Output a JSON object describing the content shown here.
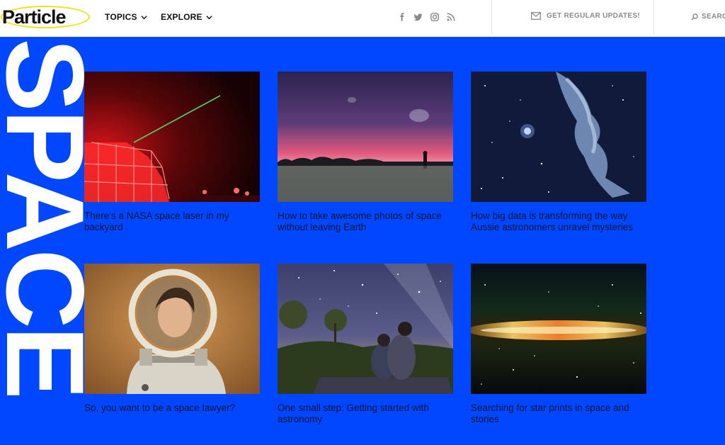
{
  "header": {
    "logo_text": "Particle",
    "nav": [
      {
        "label": "TOPICS"
      },
      {
        "label": "EXPLORE"
      }
    ],
    "social_icons": [
      "facebook-icon",
      "twitter-icon",
      "instagram-icon",
      "rss-icon"
    ],
    "updates_label": "GET REGULAR UPDATES!",
    "search_label": "SEARCH"
  },
  "section": {
    "title": "SPACE"
  },
  "articles": [
    {
      "title": "There’s a NASA space laser in my backyard"
    },
    {
      "title": "How to take awesome photos of space without leaving Earth"
    },
    {
      "title": "How big data is transforming the way Aussie astronomers unravel mysteries"
    },
    {
      "title": "So, you want to be a space lawyer?"
    },
    {
      "title": "One small step: Getting started with astronomy"
    },
    {
      "title": "Searching for star prints in space and stories"
    }
  ],
  "colors": {
    "brand_blue": "#0047ff",
    "logo_ring": "#f2e21a",
    "header_bg": "#ffffff"
  }
}
